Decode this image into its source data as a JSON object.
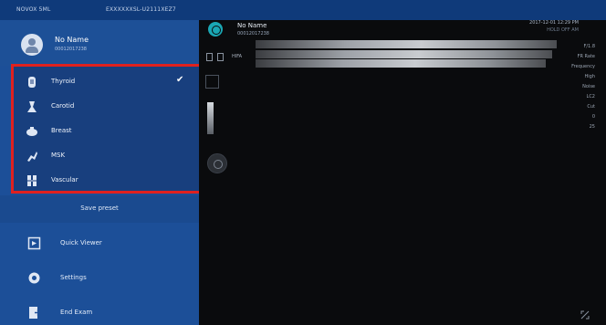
{
  "topbar": {
    "device": "NOVOX 5ML",
    "serial": "EXXXXXXSL-U2111XEZ7"
  },
  "profile": {
    "name": "No Name",
    "id": "00012017238"
  },
  "presets": [
    {
      "label": "Thyroid",
      "icon": "thyroid-icon",
      "checked": true
    },
    {
      "label": "Carotid",
      "icon": "carotid-icon",
      "checked": false
    },
    {
      "label": "Breast",
      "icon": "breast-icon",
      "checked": false
    },
    {
      "label": "MSK",
      "icon": "msk-icon",
      "checked": false
    },
    {
      "label": "Vascular",
      "icon": "vascular-icon",
      "checked": false
    }
  ],
  "checkmark": "✔",
  "save_preset": "Save preset",
  "menu": [
    {
      "label": "Quick Viewer",
      "icon": "quick-viewer-icon"
    },
    {
      "label": "Settings",
      "icon": "settings-icon"
    },
    {
      "label": "End Exam",
      "icon": "end-exam-icon"
    }
  ],
  "viewer": {
    "patient_name": "No Name",
    "patient_id": "00012017238",
    "datetime": "2017-12-01 12:29 PM",
    "subtitle": "HOLD OFF AM",
    "tool_text": "HIFA"
  },
  "params": [
    "F/1.8",
    "FR Rate",
    "Frequency",
    "High",
    "Noise",
    "LC2",
    "Cut",
    "0",
    "25"
  ],
  "colors": {
    "sidebar": "#1c4f98",
    "topbar": "#0f3a7a",
    "highlight": "#e0211f",
    "viewer_bg": "#0a0b0d",
    "accent": "#1aa7b4"
  }
}
